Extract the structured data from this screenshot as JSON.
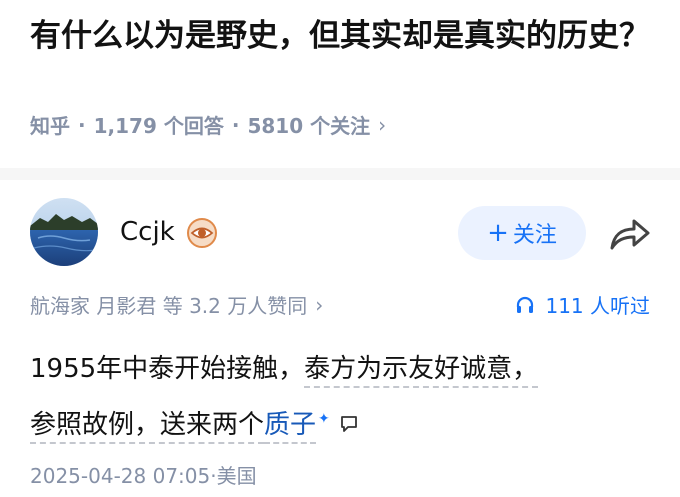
{
  "question": {
    "title": "有什么以为是野史，但其实却是真实的历史？",
    "source": "知乎",
    "sep": "·",
    "answers": "1,179 个回答",
    "followers": "5810 个关注",
    "chevron": "›"
  },
  "author": {
    "name": "Ccjk",
    "badge_icon": "eye-badge-icon",
    "follow_label": "关注",
    "follow_plus": "+",
    "share_icon": "share-arrow-icon"
  },
  "stats": {
    "endorsement": "航海家 月影君 等 3.2 万人赞同",
    "chevron": "›",
    "listen": "111 人听过",
    "listen_icon": "headphones-icon"
  },
  "content": {
    "line1_a": "1955年中泰开始接触，",
    "line1_b": "泰方为示友好诚意，",
    "line2_a": "参照故例，送来两个",
    "line2_link": "质子",
    "spark": "✦",
    "comment_icon": "comment-icon"
  },
  "footer": {
    "date": "2025-04-28 07:05·美国"
  },
  "colors": {
    "accent": "#1772f6",
    "link": "#1759b8",
    "meta": "#8590a6",
    "follow_bg": "#ebf2ff"
  }
}
